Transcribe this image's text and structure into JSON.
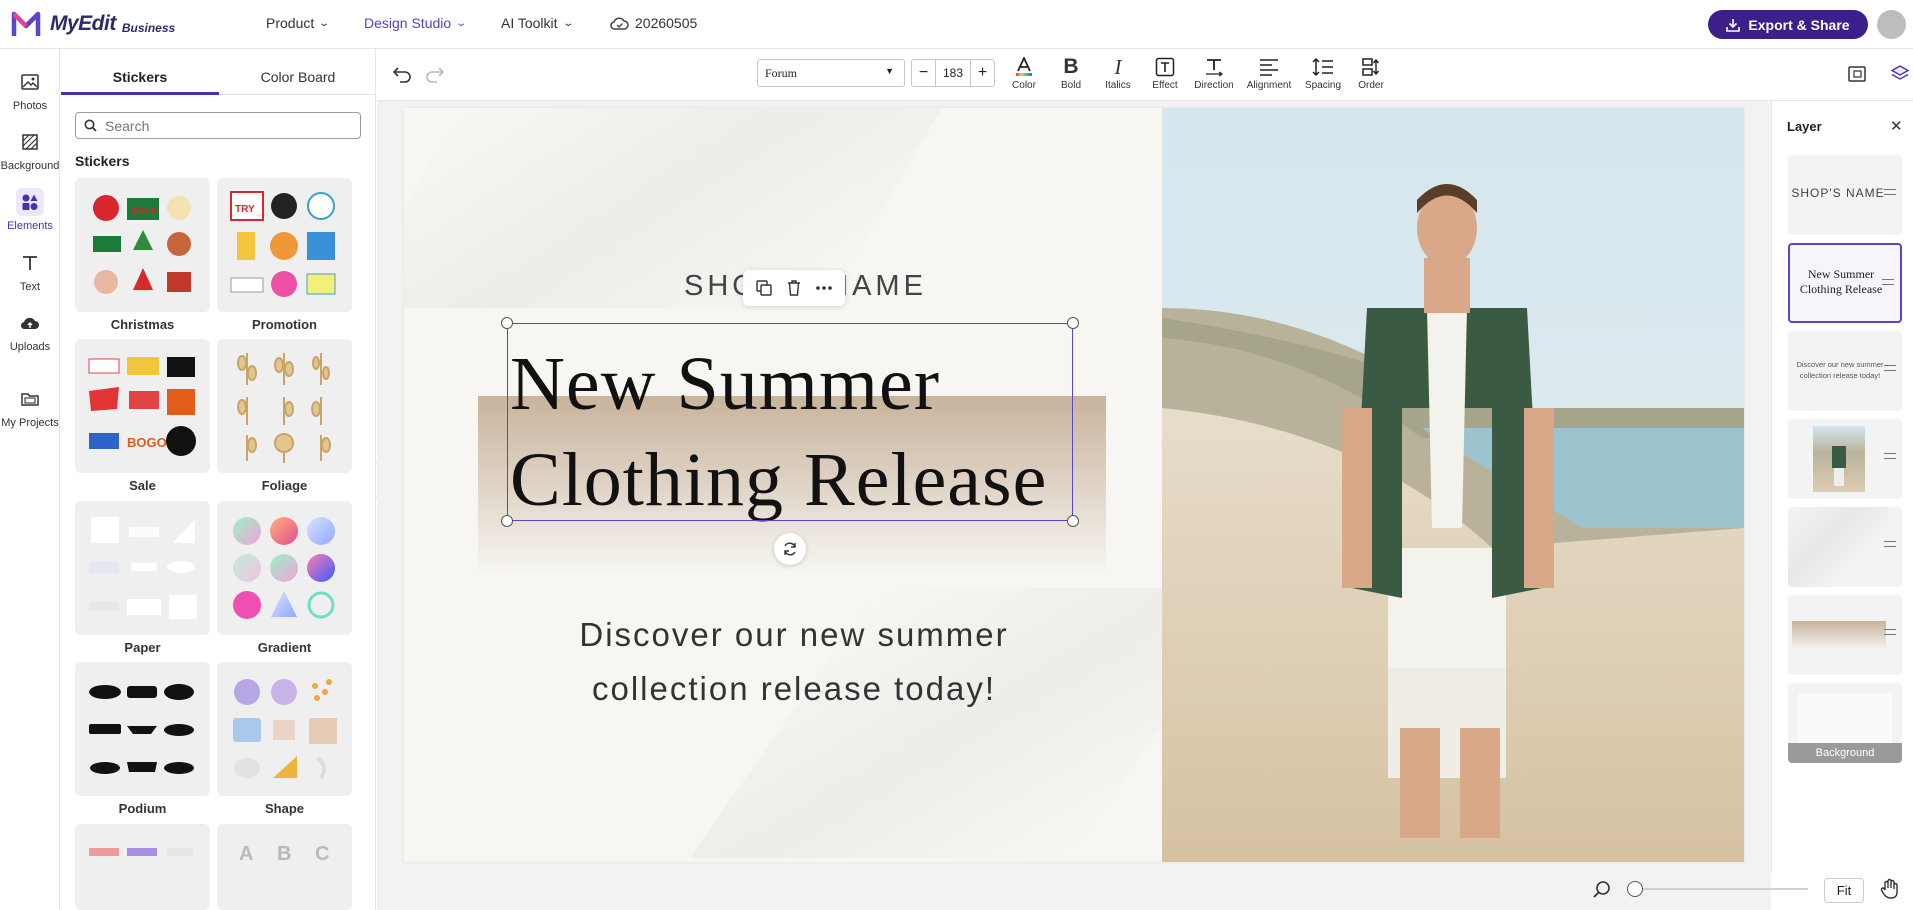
{
  "app": {
    "brand": "MyEdit",
    "brand_sub": "Business",
    "project_name": "20260505"
  },
  "nav": [
    {
      "label": "Product"
    },
    {
      "label": "Design Studio"
    },
    {
      "label": "AI Toolkit"
    }
  ],
  "header": {
    "export_label": "Export & Share"
  },
  "rail": [
    {
      "label": "Photos",
      "icon": "photo-icon"
    },
    {
      "label": "Background",
      "icon": "background-icon"
    },
    {
      "label": "Elements",
      "icon": "elements-icon"
    },
    {
      "label": "Text",
      "icon": "text-icon"
    },
    {
      "label": "Uploads",
      "icon": "cloud-upload-icon"
    },
    {
      "label": "My Projects",
      "icon": "folder-icon"
    }
  ],
  "panel": {
    "tabs": [
      {
        "label": "Stickers"
      },
      {
        "label": "Color Board"
      }
    ],
    "search_placeholder": "Search",
    "section_title": "Stickers",
    "categories": [
      {
        "label": "Christmas"
      },
      {
        "label": "Promotion"
      },
      {
        "label": "Sale"
      },
      {
        "label": "Foliage"
      },
      {
        "label": "Paper"
      },
      {
        "label": "Gradient"
      },
      {
        "label": "Podium"
      },
      {
        "label": "Shape"
      }
    ]
  },
  "toolbar": {
    "font": "Forum",
    "font_size": "183",
    "tools": [
      {
        "label": "Color"
      },
      {
        "label": "Bold"
      },
      {
        "label": "Italics"
      },
      {
        "label": "Effect"
      },
      {
        "label": "Direction"
      },
      {
        "label": "Alignment"
      },
      {
        "label": "Spacing"
      },
      {
        "label": "Order"
      }
    ]
  },
  "canvas": {
    "shop_name": "SHOP'S NAME",
    "headline_line1": "New Summer",
    "headline_line2": "Clothing Release",
    "sub_line1": "Discover our new summer",
    "sub_line2": "collection release today!"
  },
  "layers": {
    "title": "Layer",
    "items": [
      {
        "label": "SHOP'S NAME"
      },
      {
        "label": "New Summer Clothing Release"
      },
      {
        "label": "Discover our new summer collection release today!"
      },
      {
        "label": ""
      },
      {
        "label": ""
      },
      {
        "label": ""
      },
      {
        "label": "Background"
      }
    ]
  },
  "zoom": {
    "fit_label": "Fit"
  },
  "colors": {
    "accent": "#4b2fae",
    "export_bg": "#3c1f8a",
    "selection": "#5b46c9"
  }
}
